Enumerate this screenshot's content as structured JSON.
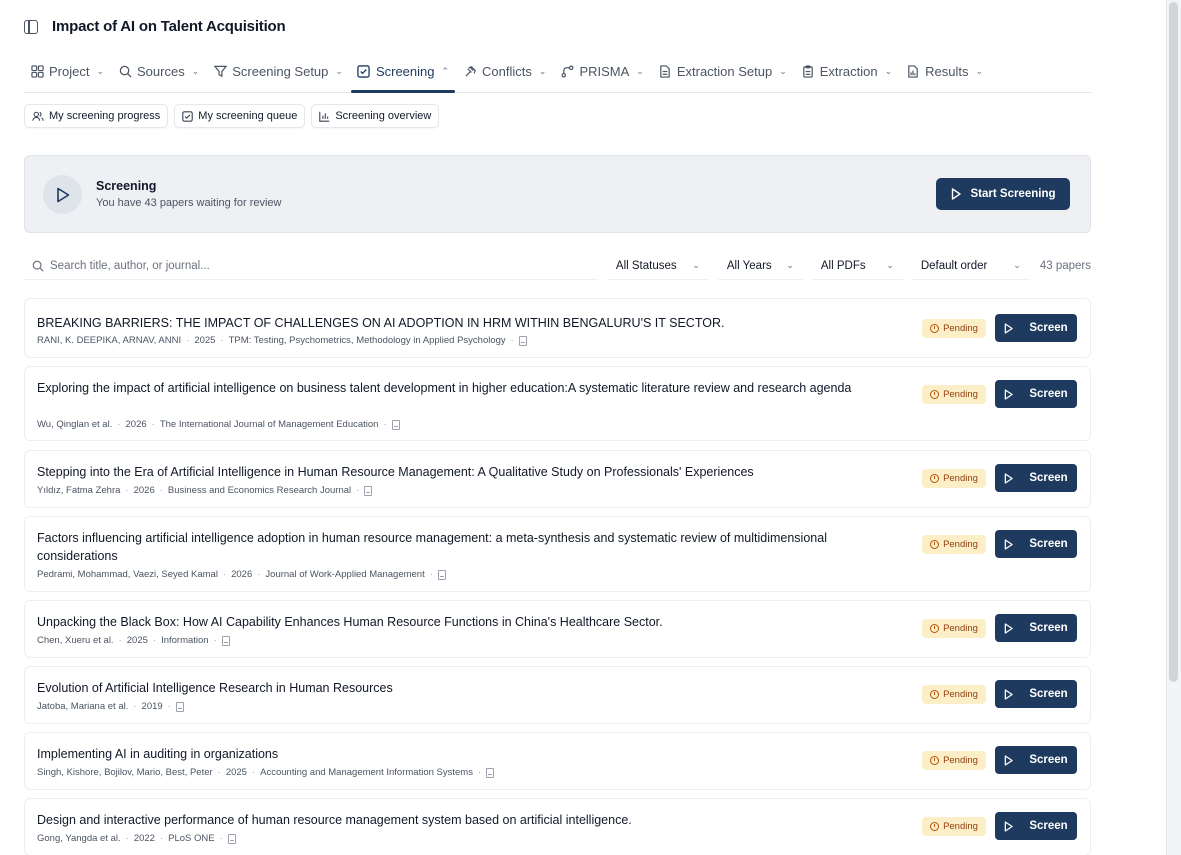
{
  "header": {
    "title": "Impact of AI on Talent Acquisition"
  },
  "nav": [
    {
      "label": "Project",
      "icon": "grid-icon"
    },
    {
      "label": "Sources",
      "icon": "search-icon"
    },
    {
      "label": "Screening Setup",
      "icon": "filter-icon"
    },
    {
      "label": "Screening",
      "icon": "checkbox-icon",
      "active": true
    },
    {
      "label": "Conflicts",
      "icon": "gavel-icon"
    },
    {
      "label": "PRISMA",
      "icon": "flow-icon"
    },
    {
      "label": "Extraction Setup",
      "icon": "document-icon"
    },
    {
      "label": "Extraction",
      "icon": "clipboard-icon"
    },
    {
      "label": "Results",
      "icon": "report-icon"
    }
  ],
  "subnav": [
    {
      "label": "My screening progress",
      "icon": "users-icon"
    },
    {
      "label": "My screening queue",
      "icon": "checkbox-icon"
    },
    {
      "label": "Screening overview",
      "icon": "bar-chart-icon"
    }
  ],
  "banner": {
    "title": "Screening",
    "subtitle": "You have 43 papers waiting for review",
    "button": "Start Screening"
  },
  "filters": {
    "search_placeholder": "Search title, author, or journal...",
    "status": "All Statuses",
    "years": "All Years",
    "pdfs": "All PDFs",
    "order": "Default order",
    "count": "43 papers"
  },
  "colors": {
    "primary": "#1e3a5f",
    "pending_bg": "#fcefc7",
    "pending_text": "#92400e"
  },
  "papers": [
    {
      "title": "BREAKING BARRIERS: THE IMPACT OF CHALLENGES ON AI ADOPTION IN HRM WITHIN BENGALURU'S IT SECTOR.",
      "authors": "RANI, K. DEEPIKA, ARNAV, ANNI",
      "year": "2025",
      "journal": "TPM: Testing, Psychometrics, Methodology in Applied Psychology",
      "status": "Pending",
      "action": "Screen"
    },
    {
      "title": "Exploring the impact of artificial intelligence on business talent development in higher education:A systematic literature review and research agenda",
      "authors": "Wu, Qinglan et al.",
      "year": "2026",
      "journal": "The International Journal of Management Education",
      "status": "Pending",
      "action": "Screen"
    },
    {
      "title": "Stepping into the Era of Artificial Intelligence in Human Resource Management: A Qualitative Study on Professionals' Experiences",
      "authors": "Yıldız, Fatma Zehra",
      "year": "2026",
      "journal": "Business and Economics Research Journal",
      "status": "Pending",
      "action": "Screen"
    },
    {
      "title": "Factors influencing artificial intelligence adoption in human resource management: a meta-synthesis and systematic review of multidimensional considerations",
      "authors": "Pedrami, Mohammad, Vaezi, Seyed Kamal",
      "year": "2026",
      "journal": "Journal of Work-Applied Management",
      "status": "Pending",
      "action": "Screen"
    },
    {
      "title": "Unpacking the Black Box: How AI Capability Enhances Human Resource Functions in China's Healthcare Sector.",
      "authors": "Chen, Xueru et al.",
      "year": "2025",
      "journal": "Information",
      "status": "Pending",
      "action": "Screen"
    },
    {
      "title": "Evolution of Artificial Intelligence Research in Human Resources",
      "authors": "Jatoba, Mariana et al.",
      "year": "2019",
      "journal": "",
      "status": "Pending",
      "action": "Screen"
    },
    {
      "title": "Implementing AI in auditing in organizations",
      "authors": "Singh, Kishore, Bojilov, Mario, Best, Peter",
      "year": "2025",
      "journal": "Accounting and Management Information Systems",
      "status": "Pending",
      "action": "Screen"
    },
    {
      "title": "Design and interactive performance of human resource management system based on artificial intelligence.",
      "authors": "Gong, Yangda et al.",
      "year": "2022",
      "journal": "PLoS ONE",
      "status": "Pending",
      "action": "Screen"
    }
  ]
}
